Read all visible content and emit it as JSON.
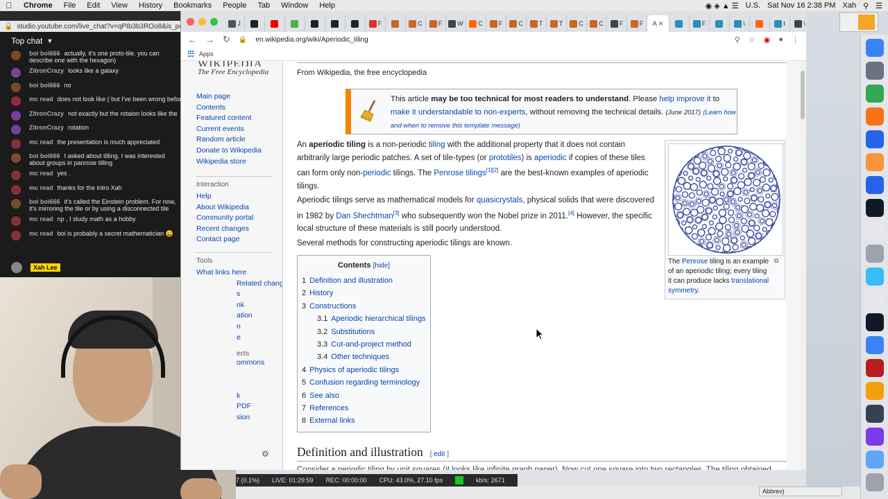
{
  "menubar": {
    "app": "Chrome",
    "items": [
      "File",
      "Edit",
      "View",
      "History",
      "Bookmarks",
      "People",
      "Tab",
      "Window",
      "Help"
    ],
    "input_source": "U.S.",
    "clock": "Sat Nov 16  2:38 PM",
    "user": "Xah"
  },
  "yt": {
    "url": "studio.youtube.com/live_chat?v=qPIb3b3ROo8&is_po",
    "chat_mode": "Top chat",
    "messages": [
      {
        "author": "boi boi666",
        "text": "actually, it's one proto-tile. you can describe one with the hexagon)",
        "color": "#7b4a2a"
      },
      {
        "author": "ZitronCrazy",
        "text": "looks like a galaxy",
        "color": "#7a3fa0"
      },
      {
        "author": "boi boi666",
        "text": "no",
        "color": "#7b4a2a"
      },
      {
        "author": "mc read",
        "text": "does not look like ( but I've been wrong before",
        "color": "#8a2f3a"
      },
      {
        "author": "ZitronCrazy",
        "text": "not exactly but the rotaion looks like the",
        "color": "#7a3fa0"
      },
      {
        "author": "ZitronCrazy",
        "text": "rotation",
        "color": "#7a3fa0"
      },
      {
        "author": "mc read",
        "text": "the presentation is much appreciated",
        "color": "#8a2f3a"
      },
      {
        "author": "boi boi666",
        "text": "I asked about tilling. I was interested about groups in panrose tilling",
        "color": "#7b4a2a"
      },
      {
        "author": "mc read",
        "text": "yes .",
        "color": "#8a2f3a"
      },
      {
        "author": "mc read",
        "text": "thanks for the intro Xah",
        "color": "#8a2f3a"
      },
      {
        "author": "boi boi666",
        "text": "it's called the Einstein problem. For now, it's mirroring the tile or by using a disconnected tile",
        "color": "#7b4a2a"
      },
      {
        "author": "mc read",
        "text": "np , I study math as a hobby",
        "color": "#8a2f3a"
      },
      {
        "author": "mc read",
        "text": "boi is probably a secret mathematician 😀",
        "color": "#8a2f3a"
      }
    ],
    "owner_badge": "Xah Lee"
  },
  "obs": {
    "cpu_left": "7 (0.1%)",
    "live": "LIVE: 01:29:59",
    "rec": "REC: 00:00:00",
    "cpu": "CPU: 43.0%, 27.10 fps",
    "kbs": "kb/s: 2671",
    "abbrev": "Abbrev)"
  },
  "chrome": {
    "tabs": [
      {
        "label": "J",
        "color": "#555"
      },
      {
        "label": "",
        "color": "#222"
      },
      {
        "label": "",
        "color": "#e00"
      },
      {
        "label": "",
        "color": "#4caf50"
      },
      {
        "label": "",
        "color": "#222"
      },
      {
        "label": "",
        "color": "#222"
      },
      {
        "label": "",
        "color": "#222"
      },
      {
        "label": "F",
        "color": "#d33"
      },
      {
        "label": "",
        "color": "#c62"
      },
      {
        "label": "C",
        "color": "#c62"
      },
      {
        "label": "F",
        "color": "#c62"
      },
      {
        "label": "W",
        "color": "#444"
      },
      {
        "label": "C",
        "color": "#f60"
      },
      {
        "label": "F",
        "color": "#c62"
      },
      {
        "label": "C",
        "color": "#c62"
      },
      {
        "label": "T",
        "color": "#c62"
      },
      {
        "label": "T",
        "color": "#c62"
      },
      {
        "label": "C",
        "color": "#c62"
      },
      {
        "label": "C",
        "color": "#c62"
      },
      {
        "label": "F",
        "color": "#444"
      },
      {
        "label": "F",
        "color": "#c62"
      }
    ],
    "active_tab": "A",
    "tabs_after": [
      {
        "label": "",
        "color": "#2a8fb8"
      },
      {
        "label": "F",
        "color": "#2a8fb8"
      },
      {
        "label": "",
        "color": "#2a8fb8"
      },
      {
        "label": "\\",
        "color": "#2a8fb8"
      },
      {
        "label": "",
        "color": "#f60"
      },
      {
        "label": "t",
        "color": "#2a8fb8"
      },
      {
        "label": "\\",
        "color": "#444"
      },
      {
        "label": "E",
        "color": "#444"
      }
    ],
    "url": "en.wikipedia.org/wiki/Aperiodic_tiling",
    "bookmarks_label": "Apps"
  },
  "wiki": {
    "logo_sub": "The Free Encyclopedia",
    "nav": [
      "Main page",
      "Contents",
      "Featured content",
      "Current events",
      "Random article",
      "Donate to Wikipedia",
      "Wikipedia store"
    ],
    "interaction_heading": "Interaction",
    "interaction": [
      "Help",
      "About Wikipedia",
      "Community portal",
      "Recent changes",
      "Contact page"
    ],
    "tools_heading": "Tools",
    "tools": [
      "What links here",
      "Related changes"
    ],
    "tools_partial": [
      "s",
      "nk",
      "ation",
      "n",
      "e"
    ],
    "projects_partial": "ects",
    "commons_partial": "ommons",
    "print_partial": [
      "k",
      "PDF",
      "sion"
    ],
    "from": "From Wikipedia, the free encyclopedia",
    "ambox": {
      "pre": "This article ",
      "bold": "may be too technical for most readers to understand",
      "mid": ". Please ",
      "link1": "help improve it",
      "to": " to",
      "link2": "make it understandable to non-experts",
      "post": ", without removing the technical details.",
      "date": "(June 2017)",
      "learn": "(Learn how and when to remove this template message)"
    },
    "p1": {
      "a": "An ",
      "b": "aperiodic tiling",
      "c": " is a non-periodic ",
      "d": "tiling",
      "e": " with the additional property that it does not contain arbitrarily large periodic patches. A set of tile-types (or ",
      "f": "prototiles",
      "g": ") is ",
      "h": "aperiodic",
      "i": " if copies of these tiles can form only non-",
      "j": "periodic",
      "k": " tilings. The ",
      "l": "Penrose tilings",
      "m": "[1][2]",
      "n": " are the best-known examples of aperiodic tilings."
    },
    "p2": {
      "a": "Aperiodic tilings serve as mathematical models for ",
      "b": "quasicrystals",
      "c": ", physical solids that were discovered in 1982 by ",
      "d": "Dan Shechtman",
      "e": "[3]",
      "f": " who subsequently won the Nobel prize in 2011.",
      "g": "[4]",
      "h": " However, the specific local structure of these materials is still poorly understood."
    },
    "p3": "Several methods for constructing aperiodic tilings are known.",
    "infobox": {
      "a": "The ",
      "b": "Penrose",
      "c": " tiling",
      "d": " is an example of an aperiodic tiling; every tiling it can produce lacks ",
      "e": "translational symmetry",
      "f": "."
    },
    "toc": {
      "title": "Contents",
      "hide": "[hide]",
      "items": [
        {
          "num": "1",
          "label": "Definition and illustration",
          "sub": false
        },
        {
          "num": "2",
          "label": "History",
          "sub": false
        },
        {
          "num": "3",
          "label": "Constructions",
          "sub": false
        },
        {
          "num": "3.1",
          "label": "Aperiodic hierarchical tilings",
          "sub": true
        },
        {
          "num": "3.2",
          "label": "Substitutions",
          "sub": true
        },
        {
          "num": "3.3",
          "label": "Cut-and-project method",
          "sub": true
        },
        {
          "num": "3.4",
          "label": "Other techniques",
          "sub": true
        },
        {
          "num": "4",
          "label": "Physics of aperiodic tilings",
          "sub": false
        },
        {
          "num": "5",
          "label": "Confusion regarding terminology",
          "sub": false
        },
        {
          "num": "6",
          "label": "See also",
          "sub": false
        },
        {
          "num": "7",
          "label": "References",
          "sub": false
        },
        {
          "num": "8",
          "label": "External links",
          "sub": false
        }
      ]
    },
    "h2": "Definition and illustration",
    "edit_open": "[ ",
    "edit": "edit",
    "edit_close": " ]",
    "cutline": "Consider a periodic tiling by unit squares (it looks like infinite graph paper). Now cut one square into two rectangles. The tiling obtained"
  },
  "colors": {
    "link": "#0645ad",
    "ambox_border": "#f28500",
    "tiling_blue": "#3b4aa0"
  }
}
